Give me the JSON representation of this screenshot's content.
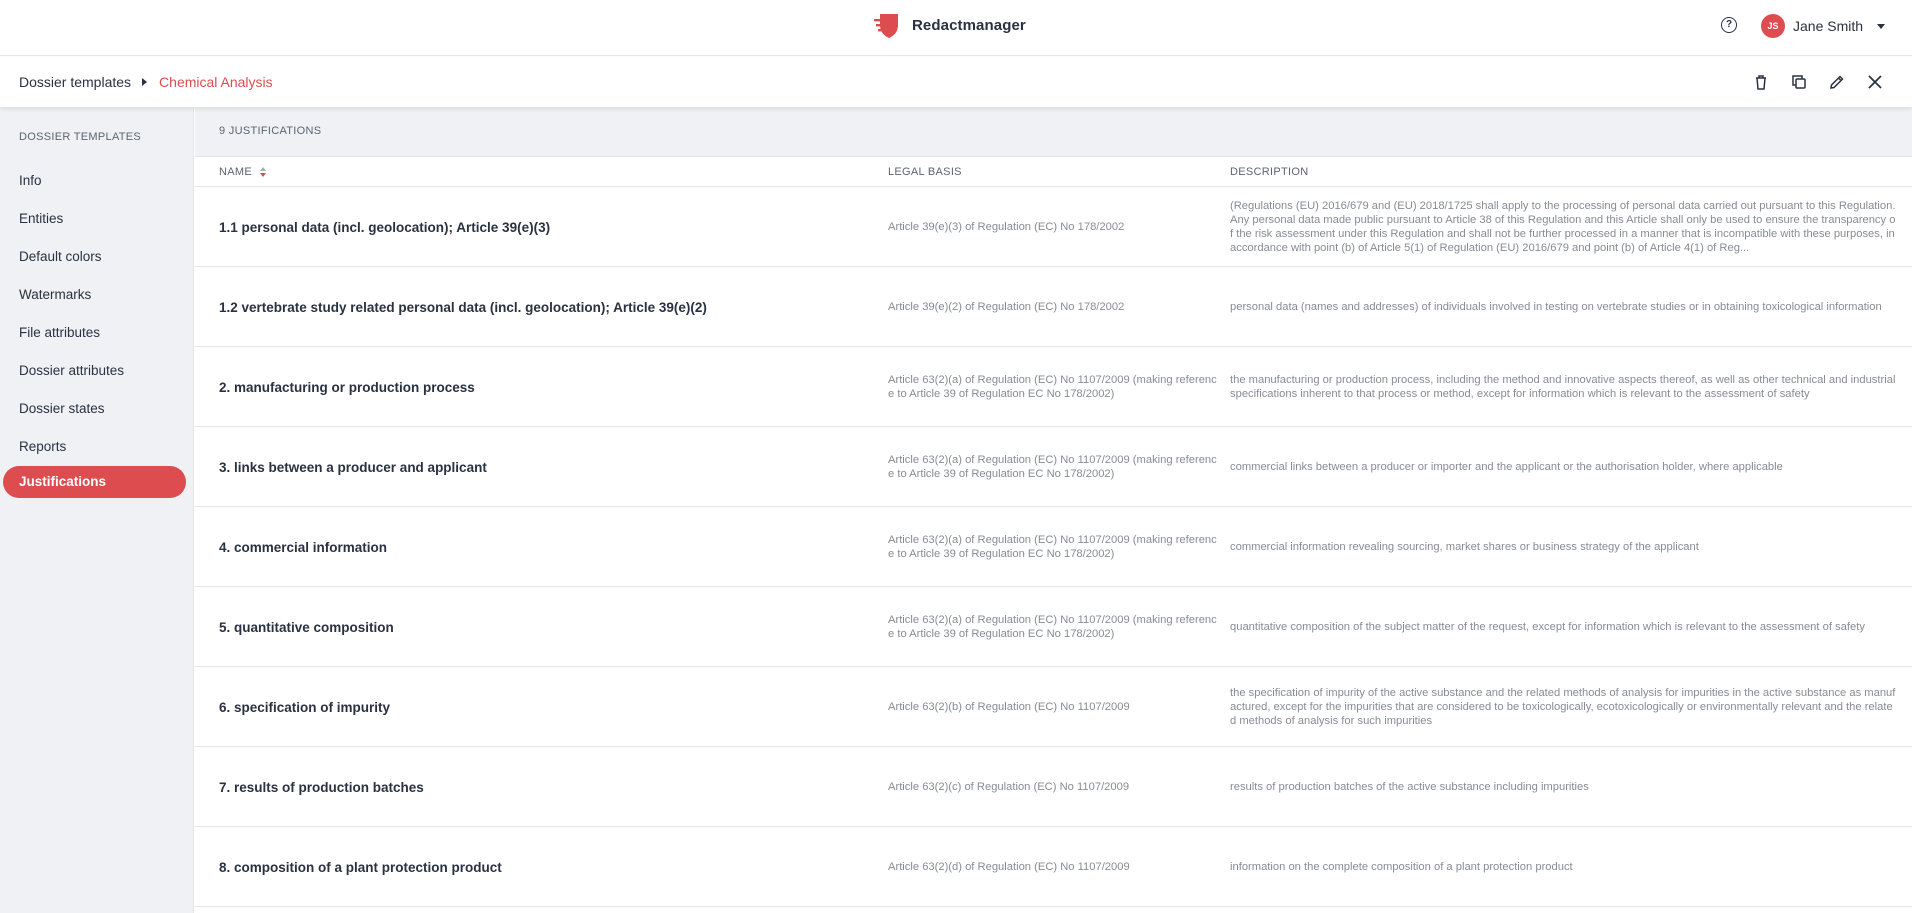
{
  "app": {
    "name": "Redactmanager"
  },
  "user": {
    "initials": "JS",
    "name": "Jane Smith"
  },
  "breadcrumb": {
    "parent": "Dossier templates",
    "current": "Chemical Analysis"
  },
  "sidebar": {
    "header": "DOSSIER TEMPLATES",
    "items": [
      {
        "label": "Info"
      },
      {
        "label": "Entities"
      },
      {
        "label": "Default colors"
      },
      {
        "label": "Watermarks"
      },
      {
        "label": "File attributes"
      },
      {
        "label": "Dossier attributes"
      },
      {
        "label": "Dossier states"
      },
      {
        "label": "Reports"
      },
      {
        "label": "Justifications",
        "active": true
      }
    ]
  },
  "main": {
    "count_label": "9 JUSTIFICATIONS",
    "columns": {
      "name": "NAME",
      "legal_basis": "LEGAL BASIS",
      "description": "DESCRIPTION"
    },
    "rows": [
      {
        "name": "1.1 personal data (incl. geolocation); Article 39(e)(3)",
        "legal_basis": "Article 39(e)(3) of Regulation (EC) No 178/2002",
        "description": "(Regulations (EU) 2016/679 and (EU) 2018/1725 shall apply to the processing of personal data carried out pursuant to this Regulation. Any personal data made public pursuant to Article 38 of this Regulation and this Article shall only be used to ensure the transparency of the risk assessment under this Regulation and shall not be further processed in a manner that is incompatible with these purposes, in accordance with point (b) of Article 5(1) of Regulation (EU) 2016/679 and point (b) of Article 4(1) of Reg..."
      },
      {
        "name": "1.2 vertebrate study related personal data (incl. geolocation); Article 39(e)(2)",
        "legal_basis": "Article 39(e)(2) of Regulation (EC) No 178/2002",
        "description": "personal data (names and addresses) of individuals involved in testing on vertebrate studies or in obtaining toxicological information"
      },
      {
        "name": "2. manufacturing or production process",
        "legal_basis": "Article 63(2)(a) of Regulation (EC) No 1107/2009 (making reference to Article 39 of Regulation EC No 178/2002)",
        "description": "the manufacturing or production process, including the method and innovative aspects thereof, as well as other technical and industrial specifications inherent to that process or method, except for information which is relevant to the assessment of safety"
      },
      {
        "name": "3. links between a producer and applicant",
        "legal_basis": "Article 63(2)(a) of Regulation (EC) No 1107/2009 (making reference to Article 39 of Regulation EC No 178/2002)",
        "description": "commercial links between a producer or importer and the applicant or the authorisation holder, where applicable"
      },
      {
        "name": "4. commercial information",
        "legal_basis": "Article 63(2)(a) of Regulation (EC) No 1107/2009 (making reference to Article 39 of Regulation EC No 178/2002)",
        "description": "commercial information revealing sourcing, market shares or business strategy of the applicant"
      },
      {
        "name": "5. quantitative composition",
        "legal_basis": "Article 63(2)(a) of Regulation (EC) No 1107/2009 (making reference to Article 39 of Regulation EC No 178/2002)",
        "description": "quantitative composition of the subject matter of the request, except for information which is relevant to the assessment of safety"
      },
      {
        "name": "6. specification of impurity",
        "legal_basis": "Article 63(2)(b) of Regulation (EC) No 1107/2009",
        "description": "the specification of impurity of the active substance and the related methods of analysis for impurities in the active substance as manufactured, except for the impurities that are considered to be toxicologically, ecotoxicologically or environmentally relevant and the related methods of analysis for such impurities"
      },
      {
        "name": "7. results of production batches",
        "legal_basis": "Article 63(2)(c) of Regulation (EC) No 1107/2009",
        "description": "results of production batches of the active substance including impurities"
      },
      {
        "name": "8. composition of a plant protection product",
        "legal_basis": "Article 63(2)(d) of Regulation (EC) No 1107/2009",
        "description": "information on the complete composition of a plant protection product"
      }
    ]
  },
  "colors": {
    "accent": "#dd4d50",
    "text": "#283241",
    "muted": "#868c95",
    "panel": "#f0f1f4"
  }
}
